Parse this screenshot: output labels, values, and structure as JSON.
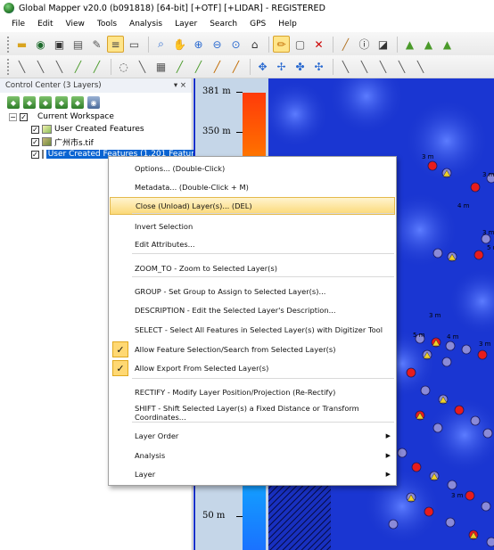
{
  "window": {
    "title": "Global Mapper v20.0 (b091818) [64-bit] [+OTF] [+LIDAR] - REGISTERED"
  },
  "menubar": [
    "File",
    "Edit",
    "View",
    "Tools",
    "Analysis",
    "Layer",
    "Search",
    "GPS",
    "Help"
  ],
  "toolbar1_icons": [
    "open-folder-icon",
    "globe-icon",
    "save-icon",
    "print-icon",
    "wrench-icon",
    "layers-icon",
    "monitor-icon",
    "zoom-rect-icon",
    "hand-pan-icon",
    "zoom-in-icon",
    "zoom-out-icon",
    "home-icon",
    "digitizer-pencil-icon",
    "select-box-icon",
    "delete-x-icon",
    "measure-icon",
    "info-icon",
    "path-profile-icon",
    "terrain-1-icon",
    "terrain-2-icon",
    "terrain-3-icon"
  ],
  "toolbar2_icons": [
    "draw-line-icon",
    "draw-line-2-icon",
    "draw-line-3-icon",
    "draw-line-4-icon",
    "draw-line-5-icon",
    "vertex-tool-icon",
    "edit-line-icon",
    "grid-tool-icon",
    "edit-area-icon",
    "edit-area-2-icon",
    "pencil-icon",
    "pencil-2-icon",
    "move-icon",
    "rotate-icon",
    "scale-icon",
    "node-icon",
    "snap-icon",
    "snap-2-icon",
    "snap-3-icon",
    "snap-4-icon",
    "snap-5-icon"
  ],
  "control_center": {
    "header": "Control Center (3 Layers)",
    "pin": "▾ ×",
    "tree": [
      {
        "label": "Current Workspace",
        "level": 0
      },
      {
        "label": "User Created Features",
        "level": 1
      },
      {
        "label": "广州市s.tif",
        "level": 1
      },
      {
        "label": "User Created Features (1,201 Featur",
        "level": 1,
        "selected": true
      }
    ]
  },
  "legend": {
    "labels": [
      "381 m",
      "350 m",
      "50 m"
    ]
  },
  "context_menu": {
    "items": [
      {
        "label": "Options... (Double-Click)"
      },
      {
        "label": "Metadata... (Double-Click + M)"
      },
      {
        "label": "Close (Unload) Layer(s)... (DEL)",
        "hover": true
      },
      {
        "label": "Invert Selection"
      },
      {
        "label": "Edit Attributes..."
      },
      {
        "label": "ZOOM_TO - Zoom to Selected Layer(s)"
      },
      {
        "label": "GROUP - Set Group to Assign to Selected Layer(s)..."
      },
      {
        "label": "DESCRIPTION - Edit the Selected Layer's Description..."
      },
      {
        "label": "SELECT - Select All Features in Selected Layer(s) with Digitizer Tool"
      },
      {
        "label": "Allow Feature Selection/Search from Selected Layer(s)",
        "checked": true
      },
      {
        "label": "Allow Export From Selected Layer(s)",
        "checked": true
      },
      {
        "label": "RECTIFY - Modify Layer Position/Projection (Re-Rectify)"
      },
      {
        "label": "SHIFT - Shift Selected Layer(s) a Fixed Distance or Transform Coordinates..."
      },
      {
        "label": "Layer Order",
        "submenu": true
      },
      {
        "label": "Analysis",
        "submenu": true
      },
      {
        "label": "Layer",
        "submenu": true
      }
    ],
    "check_glyph": "✓",
    "arrow_glyph": "▶"
  },
  "map_point_labels": [
    "3 m",
    "3 m",
    "4 m",
    "3 m",
    "5 m",
    "5 m",
    "3 m",
    "4 m",
    "3 m",
    "3 m"
  ]
}
